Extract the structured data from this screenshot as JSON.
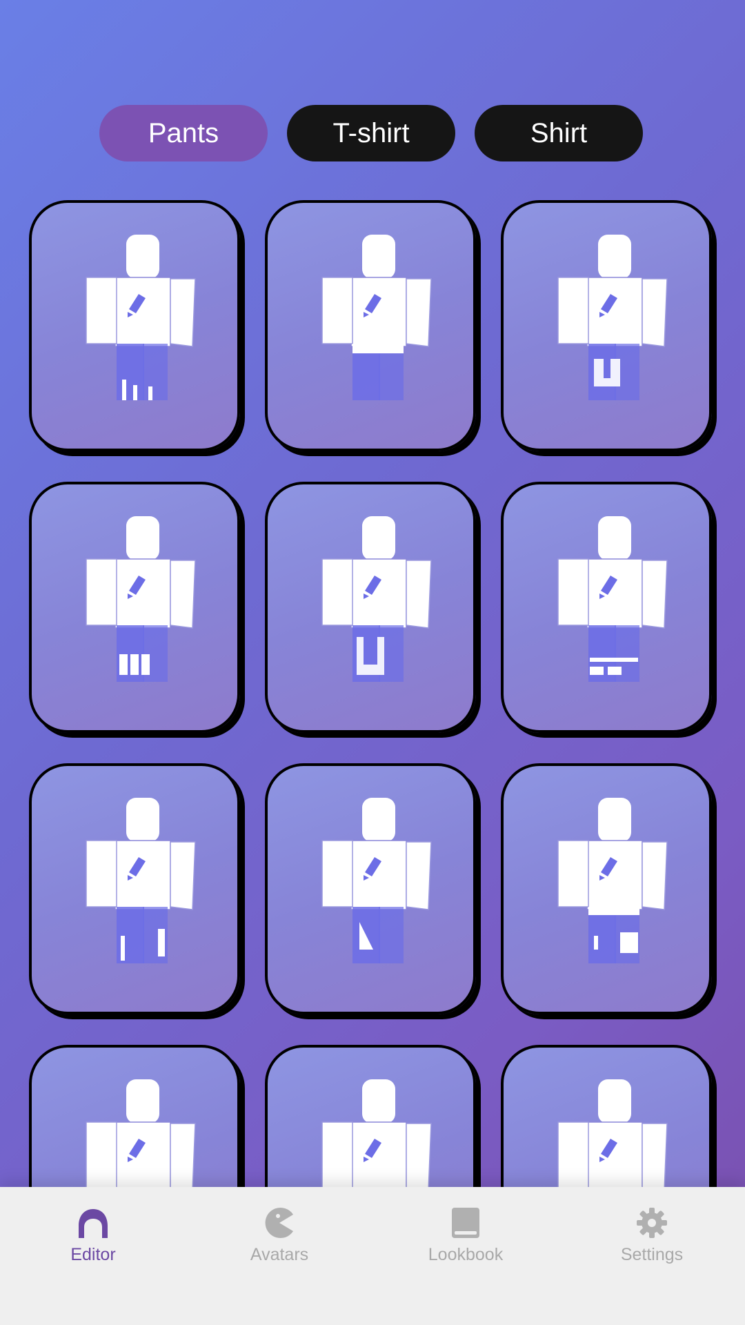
{
  "tabs": [
    {
      "label": "Pants",
      "active": true
    },
    {
      "label": "T-shirt",
      "active": false
    },
    {
      "label": "Shirt",
      "active": false
    }
  ],
  "grid": {
    "item_count": 12,
    "items": [
      {
        "name": "pants-variant-1"
      },
      {
        "name": "pants-variant-2"
      },
      {
        "name": "pants-variant-3"
      },
      {
        "name": "pants-variant-4"
      },
      {
        "name": "pants-variant-5"
      },
      {
        "name": "pants-variant-6"
      },
      {
        "name": "pants-variant-7"
      },
      {
        "name": "pants-variant-8"
      },
      {
        "name": "pants-variant-9"
      },
      {
        "name": "pants-variant-10"
      },
      {
        "name": "pants-variant-11"
      },
      {
        "name": "pants-variant-12"
      }
    ]
  },
  "navbar": {
    "items": [
      {
        "label": "Editor",
        "icon": "person-icon",
        "active": true
      },
      {
        "label": "Avatars",
        "icon": "pacman-icon",
        "active": false
      },
      {
        "label": "Lookbook",
        "icon": "book-icon",
        "active": false
      },
      {
        "label": "Settings",
        "icon": "gear-icon",
        "active": false
      }
    ]
  },
  "colors": {
    "active_tab": "#7c52b3",
    "inactive_tab": "#151515",
    "accent_nav": "#6b48a3",
    "pants_fill": "#6c6de6"
  }
}
